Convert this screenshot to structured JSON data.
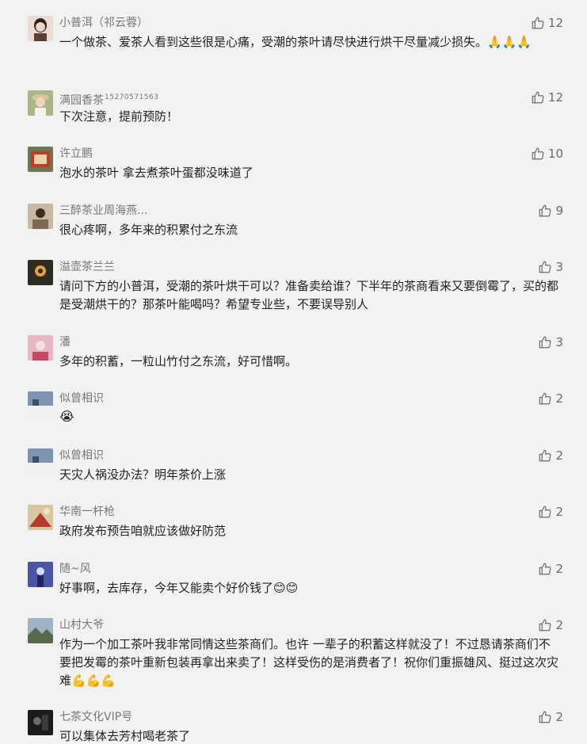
{
  "comments": [
    {
      "name": "小普洱（祁云蓉）",
      "suffix": "",
      "text": "一个做茶、爱茶人看到这些很是心痛，受潮的茶叶请尽快进行烘干尽量减少损失。🙏🙏🙏",
      "likes": "12",
      "avatar": {
        "bg": "#e9ddd6",
        "fg": "#5b4037"
      }
    },
    {
      "name": "满园香茶",
      "suffix": "15270571563",
      "text": "下次注意，提前预防！",
      "likes": "12",
      "avatar": {
        "bg": "#a9b68a",
        "fg": "#5f6d45"
      }
    },
    {
      "name": "许立鹏",
      "suffix": "",
      "text": "泡水的茶叶 拿去煮茶叶蛋都没味道了",
      "likes": "10",
      "avatar": {
        "bg": "#6c7756",
        "fg": "#c03a2b"
      }
    },
    {
      "name": "三醉茶业周海燕...",
      "suffix": "",
      "text": "很心疼啊，多年来的积累付之东流",
      "likes": "9",
      "avatar": {
        "bg": "#c9b9a3",
        "fg": "#3b2f23"
      }
    },
    {
      "name": "溢壶茶兰兰",
      "suffix": "",
      "text": "请问下方的小普洱，受潮的茶叶烘干可以？准备卖给谁？下半年的茶商看来又要倒霉了，买的都是受潮烘干的？那茶叶能喝吗？希望专业些，不要误导别人",
      "likes": "3",
      "avatar": {
        "bg": "#2f2a22",
        "fg": "#d9a441"
      }
    },
    {
      "name": "潘",
      "suffix": "",
      "text": "多年的积蓄，一粒山竹付之东流，好可惜啊。",
      "likes": "3",
      "avatar": {
        "bg": "#e8b7c1",
        "fg": "#c2495f"
      }
    },
    {
      "name": "似曾相识",
      "suffix": "",
      "text": "😭",
      "likes": "2",
      "avatar": {
        "bg": "#7d94b3",
        "fg": "#f1f1f1"
      }
    },
    {
      "name": "似曾相识",
      "suffix": "",
      "text": "天灾人祸没办法？明年茶价上涨",
      "likes": "2",
      "avatar": {
        "bg": "#7d94b3",
        "fg": "#f1f1f1"
      }
    },
    {
      "name": "华南一杆枪",
      "suffix": "",
      "text": "政府发布预告咱就应该做好防范",
      "likes": "2",
      "avatar": {
        "bg": "#d8c7a2",
        "fg": "#b33b2a"
      }
    },
    {
      "name": "随~风",
      "suffix": "",
      "text": "好事啊，去库存，今年又能卖个好价钱了😊😊",
      "likes": "2",
      "avatar": {
        "bg": "#4b55a4",
        "fg": "#d7dbf3"
      }
    },
    {
      "name": "山村大爷",
      "suffix": "",
      "text": "作为一个加工茶叶我非常同情这些茶商们。也许 一辈子的积蓄这样就没了！不过恳请茶商们不要把发霉的茶叶重新包装再拿出来卖了！这样受伤的是消费者了！祝你们重振雄风、挺过这次灾难💪💪💪",
      "likes": "2",
      "avatar": {
        "bg": "#566a4a",
        "fg": "#9fb3c6"
      }
    },
    {
      "name": "七茶文化VIP号",
      "suffix": "",
      "text": "可以集体去芳村喝老茶了",
      "likes": "2",
      "avatar": {
        "bg": "#1b1b1b",
        "fg": "#6b6b6b"
      }
    }
  ],
  "icons": {
    "like": "thumbs-up-icon"
  },
  "colors": {
    "background": "#f2f2f2",
    "nickname": "#777777",
    "text": "#222222",
    "like": "#6b6b6b"
  }
}
